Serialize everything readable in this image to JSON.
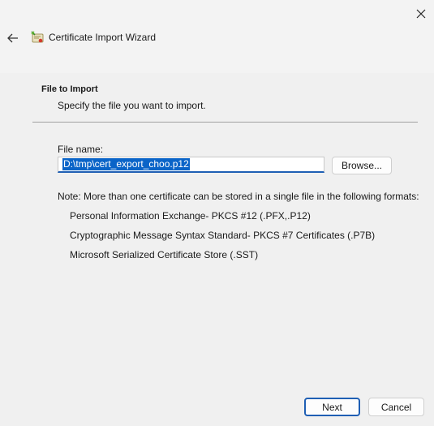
{
  "window": {
    "title": "Certificate Import Wizard"
  },
  "page": {
    "heading": "File to Import",
    "subheading": "Specify the file you want to import."
  },
  "file": {
    "label": "File name:",
    "value": "D:\\tmp\\cert_export_choo.p12",
    "browse_label": "Browse..."
  },
  "note": {
    "text": "Note:  More than one certificate can be stored in a single file in the following formats:",
    "formats": [
      "Personal Information Exchange- PKCS #12 (.PFX,.P12)",
      "Cryptographic Message Syntax Standard- PKCS #7 Certificates (.P7B)",
      "Microsoft Serialized Certificate Store (.SST)"
    ]
  },
  "footer": {
    "next_label": "Next",
    "cancel_label": "Cancel"
  },
  "icons": {
    "close": "close-icon",
    "back": "back-arrow-icon",
    "wizard": "certificate-wizard-icon"
  },
  "colors": {
    "accent": "#1f5fb4",
    "selection": "#0a64c8",
    "background": "#f0f0f0"
  }
}
